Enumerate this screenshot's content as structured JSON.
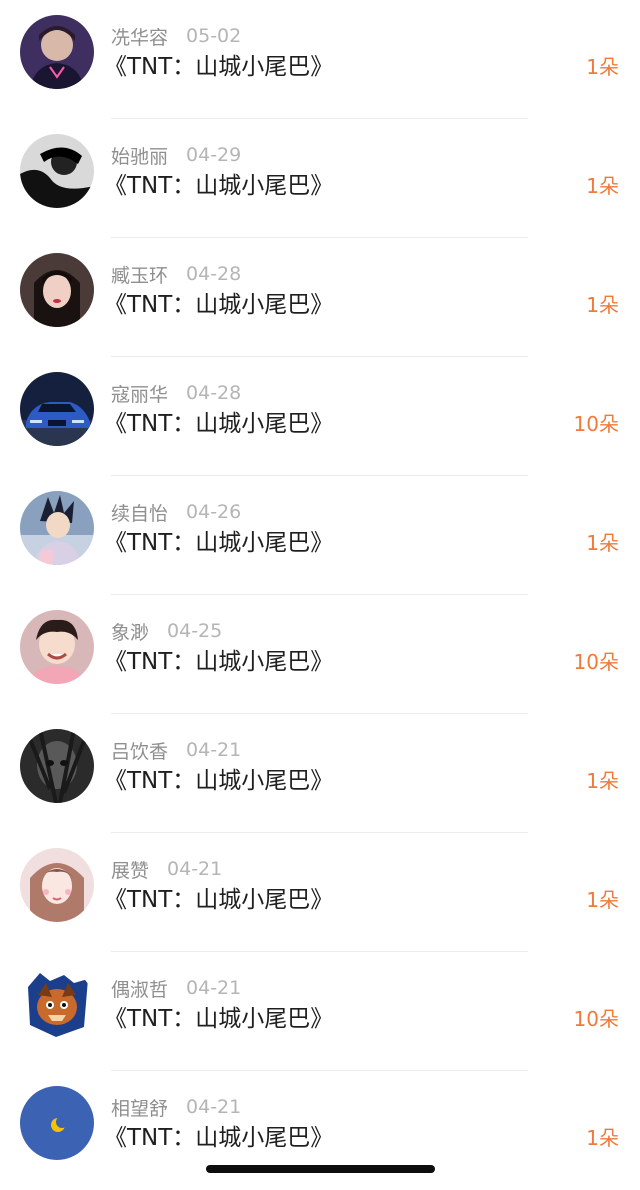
{
  "gifts": [
    {
      "name": "冼华容",
      "date": "05-02",
      "title": "《TNT：山城小尾巴》",
      "count": "1朵",
      "avatar": "avatar-man-portrait-icon",
      "bg": "#4a3a6a"
    },
    {
      "name": "始驰丽",
      "date": "04-29",
      "title": "《TNT：山城小尾巴》",
      "count": "1朵",
      "avatar": "avatar-bw-portrait-icon",
      "bg": "#bdbdbd"
    },
    {
      "name": "臧玉环",
      "date": "04-28",
      "title": "《TNT：山城小尾巴》",
      "count": "1朵",
      "avatar": "avatar-girl-portrait-icon",
      "bg": "#3b2c2a"
    },
    {
      "name": "寇丽华",
      "date": "04-28",
      "title": "《TNT：山城小尾巴》",
      "count": "10朵",
      "avatar": "avatar-car-icon",
      "bg": "#1d2d55"
    },
    {
      "name": "续自怡",
      "date": "04-26",
      "title": "《TNT：山城小尾巴》",
      "count": "1朵",
      "avatar": "avatar-anime-character-icon",
      "bg": "#7e95b5"
    },
    {
      "name": "象渺",
      "date": "04-25",
      "title": "《TNT：山城小尾巴》",
      "count": "10朵",
      "avatar": "avatar-boy-portrait-icon",
      "bg": "#e6c3c0"
    },
    {
      "name": "吕饮香",
      "date": "04-21",
      "title": "《TNT：山城小尾巴》",
      "count": "1朵",
      "avatar": "avatar-dark-portrait-icon",
      "bg": "#2a2a2a"
    },
    {
      "name": "展赞",
      "date": "04-21",
      "title": "《TNT：山城小尾巴》",
      "count": "1朵",
      "avatar": "avatar-woman-portrait-icon",
      "bg": "#efd6d6"
    },
    {
      "name": "偶淑哲",
      "date": "04-21",
      "title": "《TNT：山城小尾巴》",
      "count": "10朵",
      "avatar": "avatar-cartoon-dog-icon",
      "bg": "#ffffff"
    },
    {
      "name": "相望舒",
      "date": "04-21",
      "title": "《TNT：山城小尾巴》",
      "count": "1朵",
      "avatar": "avatar-moon-icon",
      "bg": "#3c63b4"
    }
  ],
  "colors": {
    "count_accent": "#f07a3a",
    "title_text": "#1f1f1f",
    "meta_text": "#9c9c9c"
  }
}
